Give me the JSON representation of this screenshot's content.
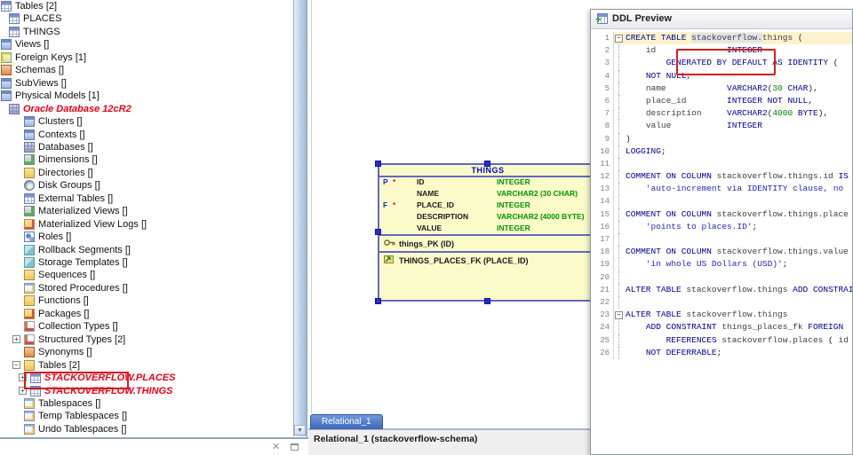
{
  "tree": {
    "items": [
      {
        "label": "Tables [2]",
        "icon": "tables-icon",
        "level": 0
      },
      {
        "label": "PLACES",
        "icon": "table-icon",
        "level": 1
      },
      {
        "label": "THINGS",
        "icon": "table-icon",
        "level": 1
      },
      {
        "label": "Views []",
        "icon": "views-icon",
        "level": 0
      },
      {
        "label": "Foreign Keys [1]",
        "icon": "foreign-keys-icon",
        "level": 0
      },
      {
        "label": "Schemas []",
        "icon": "schemas-icon",
        "level": 0
      },
      {
        "label": "SubViews []",
        "icon": "subviews-icon",
        "level": 0
      },
      {
        "label": "Physical Models [1]",
        "icon": "physical-models-icon",
        "level": 0
      },
      {
        "label": "Oracle Database 12cR2",
        "icon": "oracle-database-icon",
        "level": 1,
        "style": "red"
      },
      {
        "label": "Clusters []",
        "icon": "clusters-icon",
        "level": 2
      },
      {
        "label": "Contexts []",
        "icon": "contexts-icon",
        "level": 2
      },
      {
        "label": "Databases []",
        "icon": "databases-icon",
        "level": 2
      },
      {
        "label": "Dimensions []",
        "icon": "dimensions-icon",
        "level": 2
      },
      {
        "label": "Directories []",
        "icon": "directories-icon",
        "level": 2
      },
      {
        "label": "Disk Groups []",
        "icon": "disk-groups-icon",
        "level": 2
      },
      {
        "label": "External Tables []",
        "icon": "external-tables-icon",
        "level": 2
      },
      {
        "label": "Materialized Views []",
        "icon": "materialized-views-icon",
        "level": 2
      },
      {
        "label": "Materialized View Logs []",
        "icon": "materialized-view-logs-icon",
        "level": 2
      },
      {
        "label": "Roles []",
        "icon": "roles-icon",
        "level": 2
      },
      {
        "label": "Rollback Segments []",
        "icon": "rollback-segments-icon",
        "level": 2
      },
      {
        "label": "Storage Templates []",
        "icon": "storage-templates-icon",
        "level": 2
      },
      {
        "label": "Sequences []",
        "icon": "sequences-icon",
        "level": 2
      },
      {
        "label": "Stored Procedures []",
        "icon": "stored-procedures-icon",
        "level": 2
      },
      {
        "label": "Functions []",
        "icon": "functions-icon",
        "level": 2
      },
      {
        "label": "Packages []",
        "icon": "packages-icon",
        "level": 2
      },
      {
        "label": "Collection Types []",
        "icon": "collection-types-icon",
        "level": 2
      },
      {
        "label": "Structured Types [2]",
        "icon": "structured-types-icon",
        "level": 2,
        "expander": "plus"
      },
      {
        "label": "Synonyms []",
        "icon": "synonyms-icon",
        "level": 2
      },
      {
        "label": "Tables [2]",
        "icon": "tables-folder-icon",
        "level": 2,
        "expander": "minus"
      },
      {
        "label": "STACKOVERFLOW.PLACES",
        "icon": "table-icon",
        "level": 3,
        "expander": "plus",
        "style": "red",
        "annotated": true
      },
      {
        "label": "STACKOVERFLOW.THINGS",
        "icon": "table-icon",
        "level": 3,
        "expander": "plus",
        "style": "red"
      },
      {
        "label": "Tablespaces []",
        "icon": "tablespaces-icon",
        "level": 2
      },
      {
        "label": "Temp Tablespaces []",
        "icon": "tablespaces-icon",
        "level": 2
      },
      {
        "label": "Undo Tablespaces []",
        "icon": "tablespaces-icon",
        "level": 2
      }
    ]
  },
  "diagram": {
    "entity": {
      "title": "THINGS",
      "columns": [
        {
          "key": "P",
          "mandatory": "*",
          "name": "ID",
          "type": "INTEGER"
        },
        {
          "key": "",
          "mandatory": "",
          "name": "NAME",
          "type": "VARCHAR2 (30 CHAR)"
        },
        {
          "key": "F",
          "mandatory": "*",
          "name": "PLACE_ID",
          "type": "INTEGER"
        },
        {
          "key": "",
          "mandatory": "",
          "name": "DESCRIPTION",
          "type": "VARCHAR2 (4000 BYTE)"
        },
        {
          "key": "",
          "mandatory": "",
          "name": "VALUE",
          "type": "INTEGER"
        }
      ],
      "pk_label": "things_PK (ID)",
      "fk_label": "THINGS_PLACES_FK (PLACE_ID)"
    },
    "tab_label": "Relational_1",
    "status_text": "Relational_1 (stackoverflow-schema)"
  },
  "ddl_preview": {
    "title": "DDL Preview",
    "lines": [
      {
        "num": 1,
        "fold": "minus",
        "current": true,
        "tokens": [
          [
            "k",
            "CREATE TABLE "
          ],
          [
            "sel",
            "stackoverflow."
          ],
          [
            "i",
            "things"
          ],
          [
            "t",
            " ("
          ]
        ]
      },
      {
        "num": 2,
        "tokens": [
          [
            "t",
            "    "
          ],
          [
            "i",
            "id"
          ],
          [
            "t",
            "              "
          ],
          [
            "k",
            "INTEGER"
          ]
        ]
      },
      {
        "num": 3,
        "tokens": [
          [
            "t",
            "        "
          ],
          [
            "k",
            "GENERATED BY DEFAULT AS IDENTITY"
          ],
          [
            "t",
            " ("
          ]
        ]
      },
      {
        "num": 4,
        "tokens": [
          [
            "t",
            "    "
          ],
          [
            "k",
            "NOT NULL"
          ],
          [
            "t",
            ","
          ]
        ]
      },
      {
        "num": 5,
        "tokens": [
          [
            "t",
            "    "
          ],
          [
            "i",
            "name"
          ],
          [
            "t",
            "            "
          ],
          [
            "k",
            "VARCHAR2"
          ],
          [
            "t",
            "("
          ],
          [
            "n",
            "30"
          ],
          [
            "t",
            " "
          ],
          [
            "k",
            "CHAR"
          ],
          [
            "t",
            "),"
          ]
        ]
      },
      {
        "num": 6,
        "tokens": [
          [
            "t",
            "    "
          ],
          [
            "i",
            "place_id"
          ],
          [
            "t",
            "        "
          ],
          [
            "k",
            "INTEGER NOT NULL"
          ],
          [
            "t",
            ","
          ]
        ]
      },
      {
        "num": 7,
        "tokens": [
          [
            "t",
            "    "
          ],
          [
            "i",
            "description"
          ],
          [
            "t",
            "     "
          ],
          [
            "k",
            "VARCHAR2"
          ],
          [
            "t",
            "("
          ],
          [
            "n",
            "4000"
          ],
          [
            "t",
            " "
          ],
          [
            "k",
            "BYTE"
          ],
          [
            "t",
            "),"
          ]
        ]
      },
      {
        "num": 8,
        "tokens": [
          [
            "t",
            "    "
          ],
          [
            "i",
            "value"
          ],
          [
            "t",
            "           "
          ],
          [
            "k",
            "INTEGER"
          ]
        ]
      },
      {
        "num": 9,
        "tokens": [
          [
            "t",
            ")"
          ]
        ]
      },
      {
        "num": 10,
        "tokens": [
          [
            "k",
            "LOGGING"
          ],
          [
            "t",
            ";"
          ]
        ]
      },
      {
        "num": 11,
        "tokens": []
      },
      {
        "num": 12,
        "tokens": [
          [
            "k",
            "COMMENT ON COLUMN "
          ],
          [
            "i",
            "stackoverflow.things.id"
          ],
          [
            "t",
            " "
          ],
          [
            "k",
            "IS"
          ]
        ]
      },
      {
        "num": 13,
        "tokens": [
          [
            "t",
            "    "
          ],
          [
            "s",
            "'auto-increment via IDENTITY clause, no"
          ]
        ]
      },
      {
        "num": 14,
        "tokens": []
      },
      {
        "num": 15,
        "tokens": [
          [
            "k",
            "COMMENT ON COLUMN "
          ],
          [
            "i",
            "stackoverflow.things.place"
          ]
        ]
      },
      {
        "num": 16,
        "tokens": [
          [
            "t",
            "    "
          ],
          [
            "s",
            "'points to places.ID'"
          ],
          [
            "t",
            ";"
          ]
        ]
      },
      {
        "num": 17,
        "tokens": []
      },
      {
        "num": 18,
        "tokens": [
          [
            "k",
            "COMMENT ON COLUMN "
          ],
          [
            "i",
            "stackoverflow.things.value"
          ]
        ]
      },
      {
        "num": 19,
        "tokens": [
          [
            "t",
            "    "
          ],
          [
            "s",
            "'in whole US Dollars (USD)'"
          ],
          [
            "t",
            ";"
          ]
        ]
      },
      {
        "num": 20,
        "tokens": []
      },
      {
        "num": 21,
        "tokens": [
          [
            "k",
            "ALTER TABLE "
          ],
          [
            "i",
            "stackoverflow.things"
          ],
          [
            "t",
            " "
          ],
          [
            "k",
            "ADD CONSTRAINT"
          ]
        ]
      },
      {
        "num": 22,
        "tokens": []
      },
      {
        "num": 23,
        "fold": "minus",
        "tokens": [
          [
            "k",
            "ALTER TABLE "
          ],
          [
            "i",
            "stackoverflow.things"
          ]
        ]
      },
      {
        "num": 24,
        "tokens": [
          [
            "t",
            "    "
          ],
          [
            "k",
            "ADD CONSTRAINT "
          ],
          [
            "i",
            "things_places_fk"
          ],
          [
            "t",
            " "
          ],
          [
            "k",
            "FOREIGN"
          ]
        ]
      },
      {
        "num": 25,
        "tokens": [
          [
            "t",
            "        "
          ],
          [
            "k",
            "REFERENCES "
          ],
          [
            "i",
            "stackoverflow.places"
          ],
          [
            "t",
            " ( "
          ],
          [
            "i",
            "id"
          ]
        ]
      },
      {
        "num": 26,
        "tokens": [
          [
            "t",
            "    "
          ],
          [
            "k",
            "NOT DEFERRABLE"
          ],
          [
            "t",
            ";"
          ]
        ]
      }
    ]
  },
  "colors": {
    "annotation_red": "#d02020",
    "tree_highlight_red": "#f00016",
    "keyword_blue": "#00009c",
    "string_blue": "#2525cd",
    "number_green": "#007d00",
    "entity_type_green": "#009400",
    "entity_fill_yellow": "#fbfbca",
    "entity_border_blue": "#6666c4",
    "entity_title_blue": "#0000cc",
    "selected_tab_blue": "#3a67bd",
    "current_line_yellow": "#fcf3cd"
  }
}
